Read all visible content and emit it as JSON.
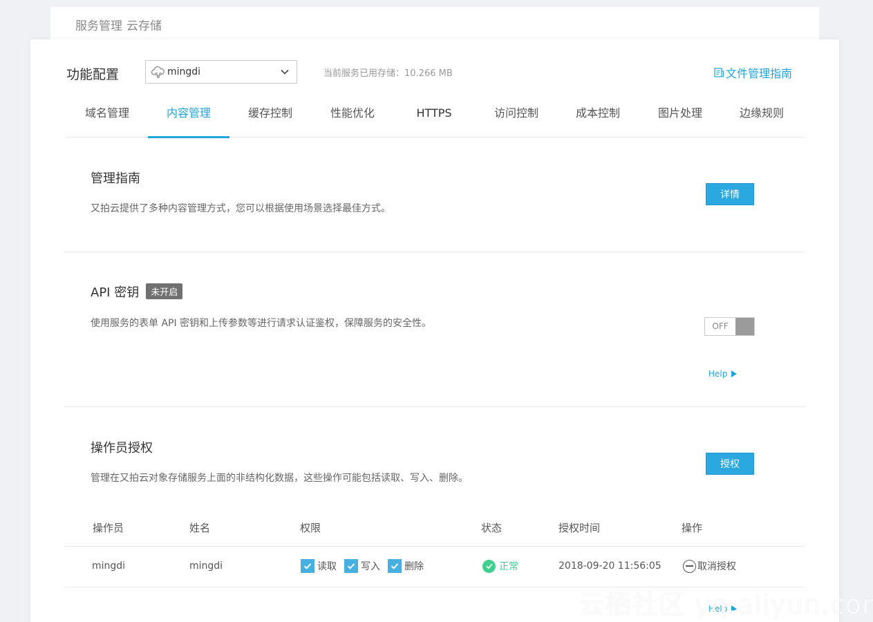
{
  "breadcrumb": [
    "服务管理",
    "云存储"
  ],
  "header": {
    "title": "功能配置",
    "service_selected": "mingdi",
    "storage_info": "当前服务已用存储：10.266 MB",
    "guide_link": "文件管理指南"
  },
  "tabs": [
    {
      "label": "域名管理"
    },
    {
      "label": "内容管理"
    },
    {
      "label": "缓存控制"
    },
    {
      "label": "性能优化"
    },
    {
      "label": "HTTPS"
    },
    {
      "label": "访问控制"
    },
    {
      "label": "成本控制"
    },
    {
      "label": "图片处理"
    },
    {
      "label": "边缘规则"
    }
  ],
  "sections": {
    "guide": {
      "title": "管理指南",
      "desc": "又拍云提供了多种内容管理方式，您可以根据使用场景选择最佳方式。",
      "button": "详情"
    },
    "api": {
      "title": "API 密钥",
      "badge": "未开启",
      "desc": "使用服务的表单 API 密钥和上传参数等进行请求认证鉴权，保障服务的安全性。",
      "toggle": "OFF",
      "help": "Help"
    },
    "operator": {
      "title": "操作员授权",
      "desc": "管理在又拍云对象存储服务上面的非结构化数据，这些操作可能包括读取、写入、删除。",
      "button": "授权",
      "help": "Help"
    }
  },
  "table": {
    "headers": [
      "操作员",
      "姓名",
      "权限",
      "状态",
      "授权时间",
      "操作"
    ],
    "rows": [
      {
        "operator": "mingdi",
        "name": "mingdi",
        "perms": [
          "读取",
          "写入",
          "删除"
        ],
        "status": "正常",
        "time": "2018-09-20 11:56:05",
        "action": "取消授权"
      }
    ]
  },
  "watermark": "云栖社区 yq.aliyun.com",
  "colors": {
    "accent": "#1fa5db",
    "success": "#3fcf8e",
    "badge": "#707070"
  }
}
